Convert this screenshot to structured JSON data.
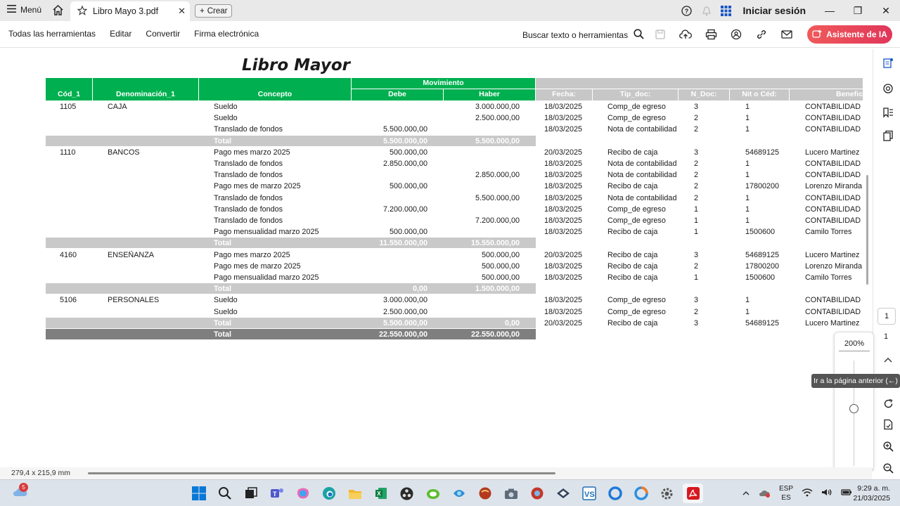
{
  "window": {
    "menu_label": "Menú",
    "tab_title": "Libro Mayo 3.pdf",
    "new_tab_label": "Crear",
    "signin_label": "Iniciar sesión"
  },
  "toolbar": {
    "items": [
      "Todas las herramientas",
      "Editar",
      "Convertir",
      "Firma electrónica"
    ],
    "search_label": "Buscar texto o herramientas",
    "ai_button": "Asistente de IA"
  },
  "document": {
    "title": "Libro Mayor",
    "headers": {
      "cod": "Cód_1",
      "denominacion": "Denominación_1",
      "concepto": "Concepto",
      "movimiento": "Movimiento",
      "debe": "Debe",
      "haber": "Haber",
      "fecha": "Fecha:",
      "tip_doc": "Tip_doc:",
      "n_doc": "N_Doc:",
      "nit": "Nit o Céd:",
      "benef": "Benefic"
    },
    "rows": [
      {
        "cod": "1105",
        "den": "CAJA",
        "concepto": "Sueldo",
        "debe": "",
        "haber": "3.000.000,00",
        "fecha": "18/03/2025",
        "tip": "Comp_de egreso",
        "ndoc": "3",
        "nit": "1",
        "benef": "CONTABILIDAD",
        "total": false
      },
      {
        "cod": "",
        "den": "",
        "concepto": "Sueldo",
        "debe": "",
        "haber": "2.500.000,00",
        "fecha": "18/03/2025",
        "tip": "Comp_de egreso",
        "ndoc": "2",
        "nit": "1",
        "benef": "CONTABILIDAD",
        "total": false
      },
      {
        "cod": "",
        "den": "",
        "concepto": "Translado de fondos",
        "debe": "5.500.000,00",
        "haber": "",
        "fecha": "18/03/2025",
        "tip": "Nota de contabilidad",
        "ndoc": "2",
        "nit": "1",
        "benef": "CONTABILIDAD",
        "total": false
      },
      {
        "cod": "",
        "den": "",
        "concepto": "Total",
        "debe": "5.500.000,00",
        "haber": "5.500.000,00",
        "fecha": "",
        "tip": "",
        "ndoc": "",
        "nit": "",
        "benef": "",
        "total": true
      },
      {
        "cod": "1110",
        "den": "BANCOS",
        "concepto": "Pago mes marzo 2025",
        "debe": "500.000,00",
        "haber": "",
        "fecha": "20/03/2025",
        "tip": "Recibo de caja",
        "ndoc": "3",
        "nit": "54689125",
        "benef": "Lucero Martinez",
        "total": false
      },
      {
        "cod": "",
        "den": "",
        "concepto": "Translado de fondos",
        "debe": "2.850.000,00",
        "haber": "",
        "fecha": "18/03/2025",
        "tip": "Nota de contabilidad",
        "ndoc": "2",
        "nit": "1",
        "benef": "CONTABILIDAD",
        "total": false
      },
      {
        "cod": "",
        "den": "",
        "concepto": "Translado de fondos",
        "debe": "",
        "haber": "2.850.000,00",
        "fecha": "18/03/2025",
        "tip": "Nota de contabilidad",
        "ndoc": "2",
        "nit": "1",
        "benef": "CONTABILIDAD",
        "total": false
      },
      {
        "cod": "",
        "den": "",
        "concepto": "Pago mes de marzo 2025",
        "debe": "500.000,00",
        "haber": "",
        "fecha": "18/03/2025",
        "tip": "Recibo de caja",
        "ndoc": "2",
        "nit": "17800200",
        "benef": "Lorenzo Miranda",
        "total": false
      },
      {
        "cod": "",
        "den": "",
        "concepto": "Translado de fondos",
        "debe": "",
        "haber": "5.500.000,00",
        "fecha": "18/03/2025",
        "tip": "Nota de contabilidad",
        "ndoc": "2",
        "nit": "1",
        "benef": "CONTABILIDAD",
        "total": false
      },
      {
        "cod": "",
        "den": "",
        "concepto": "Translado de fondos",
        "debe": "7.200.000,00",
        "haber": "",
        "fecha": "18/03/2025",
        "tip": "Comp_de egreso",
        "ndoc": "1",
        "nit": "1",
        "benef": "CONTABILIDAD",
        "total": false
      },
      {
        "cod": "",
        "den": "",
        "concepto": "Translado de fondos",
        "debe": "",
        "haber": "7.200.000,00",
        "fecha": "18/03/2025",
        "tip": "Comp_de egreso",
        "ndoc": "1",
        "nit": "1",
        "benef": "CONTABILIDAD",
        "total": false
      },
      {
        "cod": "",
        "den": "",
        "concepto": "Pago mensualidad marzo 2025",
        "debe": "500.000,00",
        "haber": "",
        "fecha": "18/03/2025",
        "tip": "Recibo de caja",
        "ndoc": "1",
        "nit": "1500600",
        "benef": "Camilo Torres",
        "total": false
      },
      {
        "cod": "",
        "den": "",
        "concepto": "Total",
        "debe": "11.550.000,00",
        "haber": "15.550.000,00",
        "fecha": "",
        "tip": "",
        "ndoc": "",
        "nit": "",
        "benef": "",
        "total": true
      },
      {
        "cod": "4160",
        "den": "ENSEÑANZA",
        "concepto": "Pago mes marzo 2025",
        "debe": "",
        "haber": "500.000,00",
        "fecha": "20/03/2025",
        "tip": "Recibo de caja",
        "ndoc": "3",
        "nit": "54689125",
        "benef": "Lucero Martinez",
        "total": false
      },
      {
        "cod": "",
        "den": "",
        "concepto": "Pago mes de marzo 2025",
        "debe": "",
        "haber": "500.000,00",
        "fecha": "18/03/2025",
        "tip": "Recibo de caja",
        "ndoc": "2",
        "nit": "17800200",
        "benef": "Lorenzo Miranda",
        "total": false
      },
      {
        "cod": "",
        "den": "",
        "concepto": "Pago mensualidad marzo 2025",
        "debe": "",
        "haber": "500.000,00",
        "fecha": "18/03/2025",
        "tip": "Recibo de caja",
        "ndoc": "1",
        "nit": "1500600",
        "benef": "Camilo Torres",
        "total": false
      },
      {
        "cod": "",
        "den": "",
        "concepto": "Total",
        "debe": "0,00",
        "haber": "1.500.000,00",
        "fecha": "",
        "tip": "",
        "ndoc": "",
        "nit": "",
        "benef": "",
        "total": true
      },
      {
        "cod": "5106",
        "den": "PERSONALES",
        "concepto": "Sueldo",
        "debe": "3.000.000,00",
        "haber": "",
        "fecha": "18/03/2025",
        "tip": "Comp_de egreso",
        "ndoc": "3",
        "nit": "1",
        "benef": "CONTABILIDAD",
        "total": false
      },
      {
        "cod": "",
        "den": "",
        "concepto": "Sueldo",
        "debe": "2.500.000,00",
        "haber": "",
        "fecha": "18/03/2025",
        "tip": "Comp_de egreso",
        "ndoc": "2",
        "nit": "1",
        "benef": "CONTABILIDAD",
        "total": false
      },
      {
        "cod": "",
        "den": "",
        "concepto": "Total",
        "debe": "5.500.000,00",
        "haber": "0,00",
        "fecha": "20/03/2025",
        "tip": "Recibo de caja",
        "ndoc": "3",
        "nit": "54689125",
        "benef": "Lucero Martinez",
        "total": true
      },
      {
        "cod": "",
        "den": "",
        "concepto": "Total",
        "debe": "22.550.000,00",
        "haber": "22.550.000,00",
        "fecha": "",
        "tip": "",
        "ndoc": "",
        "nit": "",
        "benef": "",
        "total": "grand"
      }
    ]
  },
  "status": {
    "page_size": "279,4 x 215,9 mm",
    "page_number": "1",
    "page_total": "1",
    "zoom": "200%",
    "tooltip": "Ir a la página anterior (←)"
  },
  "taskbar": {
    "notification_count": "5",
    "lang_top": "ESP",
    "lang_bottom": "ES",
    "time": "9:29 a. m.",
    "date": "21/03/2025"
  },
  "colors": {
    "header_green": "#00b050",
    "header_grey": "#c7c7c7",
    "total_grey": "#c9c9c9",
    "grand_total": "#7f7f7f",
    "ai_button": "#e0365a",
    "active_tool": "#1473e6"
  }
}
